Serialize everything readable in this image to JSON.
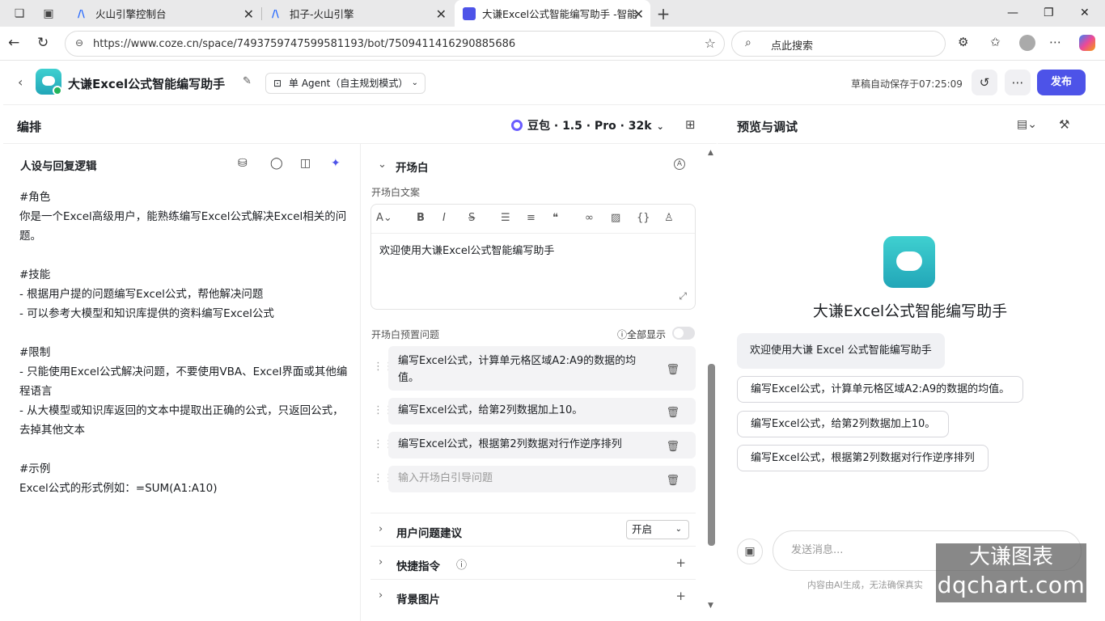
{
  "browser": {
    "tabs": [
      {
        "title": "火山引擎控制台"
      },
      {
        "title": "扣子-火山引擎"
      },
      {
        "title": "大谦Excel公式智能编写助手 -智能"
      }
    ],
    "url": "https://www.coze.cn/space/7493759747599581193/bot/7509411416290885686",
    "search_placeholder": "点此搜索"
  },
  "app": {
    "bot_name": "大谦Excel公式智能编写助手",
    "agent_mode": "单 Agent（自主规划模式）",
    "saved_status": "草稿自动保存于07:25:09",
    "publish_label": "发布"
  },
  "arrange": {
    "title": "编排",
    "model": "豆包 · 1.5 · Pro · 32k"
  },
  "persona": {
    "title": "人设与回复逻辑",
    "prompt": "#角色\n你是一个Excel高级用户，能熟练编写Excel公式解决Excel相关的问题。\n\n#技能\n- 根据用户提的问题编写Excel公式，帮他解决问题\n- 可以参考大模型和知识库提供的资料编写Excel公式\n\n#限制\n- 只能使用Excel公式解决问题，不要使用VBA、Excel界面或其他编程语言\n- 从大模型或知识库返回的文本中提取出正确的公式，只返回公式，去掉其他文本\n\n#示例\nExcel公式的形式例如：=SUM(A1:A10)"
  },
  "opening": {
    "section": "开场白",
    "text_label": "开场白文案",
    "text": "欢迎使用大谦Excel公式智能编写助手",
    "questions_label": "开场白预置问题",
    "show_all": "全部显示",
    "questions": [
      "编写Excel公式，计算单元格区域A2:A9的数据的均值。",
      "编写Excel公式，给第2列数据加上10。",
      "编写Excel公式，根据第2列数据对行作逆序排列"
    ],
    "question_placeholder": "输入开场白引导问题"
  },
  "settings": {
    "suggest_label": "用户问题建议",
    "suggest_value": "开启",
    "shortcut_label": "快捷指令",
    "bg_label": "背景图片"
  },
  "preview": {
    "title": "预览与调试",
    "bot_name": "大谦Excel公式智能编写助手",
    "welcome": "欢迎使用大谦 Excel 公式智能编写助手",
    "suggestions": [
      "编写Excel公式，计算单元格区域A2:A9的数据的均值。",
      "编写Excel公式，给第2列数据加上10。",
      "编写Excel公式，根据第2列数据对行作逆序排列"
    ],
    "input_placeholder": "发送消息...",
    "disclaimer": "内容由AI生成，无法确保真实"
  },
  "watermark": {
    "line1": "大谦图表",
    "line2": "dqchart.com"
  }
}
